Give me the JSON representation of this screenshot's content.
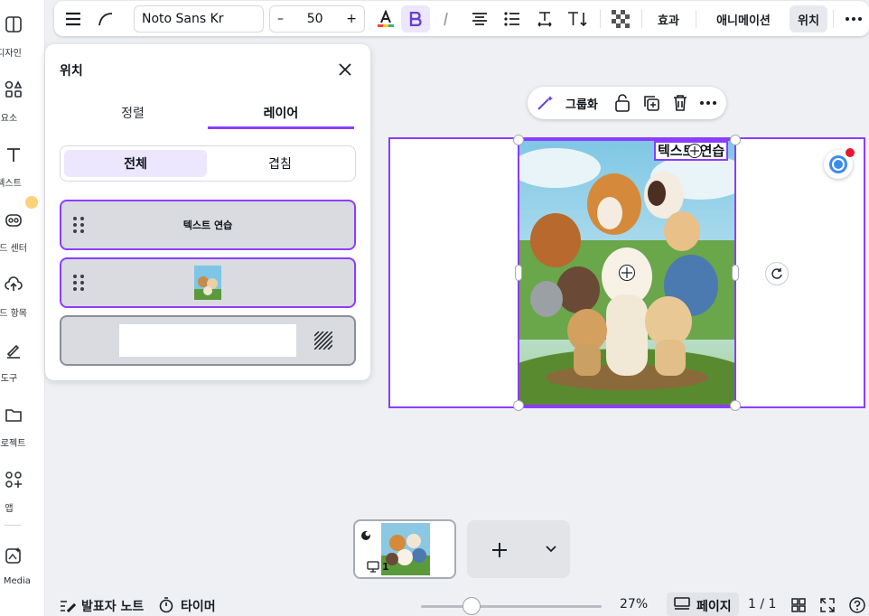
{
  "sidebar": {
    "items": [
      {
        "label": "디자인",
        "icon": "layout-icon"
      },
      {
        "label": "요소",
        "icon": "elements-icon"
      },
      {
        "label": "텍스트",
        "icon": "text-icon"
      },
      {
        "label": "랜드 센터",
        "icon": "brand-icon"
      },
      {
        "label": "로드 항목",
        "icon": "upload-icon"
      },
      {
        "label": "도구",
        "icon": "draw-icon"
      },
      {
        "label": "프로젝트",
        "icon": "folder-icon"
      },
      {
        "label": "앱",
        "icon": "apps-icon"
      },
      {
        "label": "gic Media",
        "icon": "magic-media-icon"
      }
    ]
  },
  "toolbar": {
    "font_name": "Noto Sans Kr",
    "font_size": "50",
    "decrease_label": "–",
    "increase_label": "+",
    "effects_label": "효과",
    "animate_label": "애니메이션",
    "position_label": "위치"
  },
  "panel": {
    "title": "위치",
    "tabs": [
      "정렬",
      "레이어"
    ],
    "active_tab": "레이어",
    "segments": [
      "전체",
      "겹침"
    ],
    "active_segment": "전체",
    "layers": [
      {
        "label": "텍스트 연습",
        "kind": "text"
      },
      {
        "label": "",
        "kind": "image"
      },
      {
        "label": "",
        "kind": "background"
      }
    ]
  },
  "canvas": {
    "text": "텍스트 연습",
    "group_label": "그룹화"
  },
  "pages": {
    "page_number": "1"
  },
  "footer": {
    "notes_label": "발표자 노트",
    "timer_label": "타이머",
    "zoom": "27%",
    "zoom_fraction": 0.27,
    "page_label": "페이지",
    "page_count": "1 / 1"
  },
  "colors": {
    "accent": "#8b3dff",
    "accent_light": "#ece6ff",
    "notification": "#e8162e"
  }
}
